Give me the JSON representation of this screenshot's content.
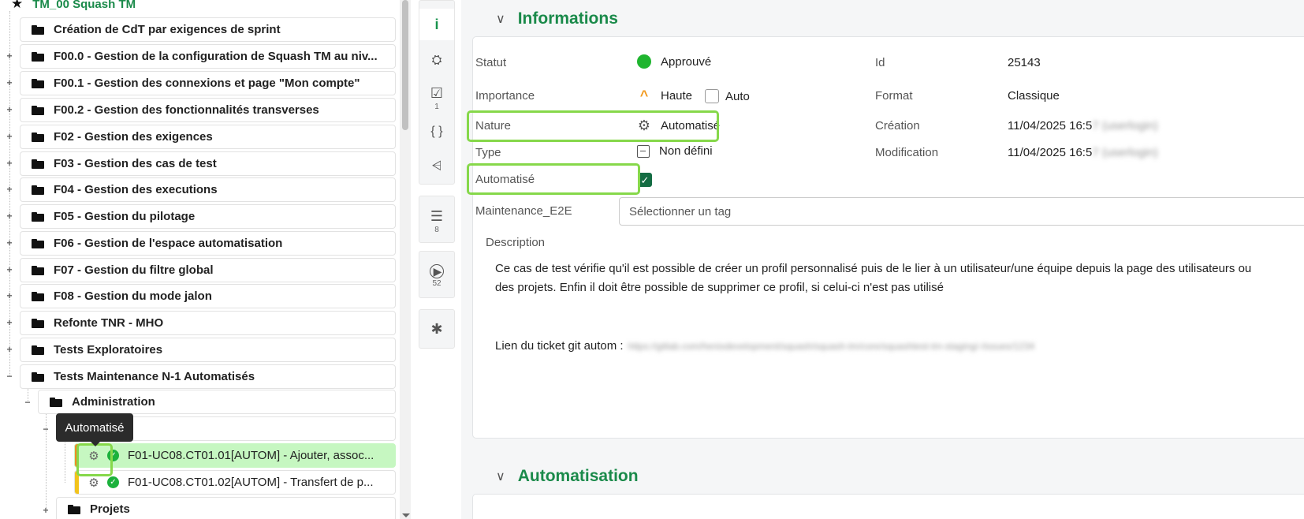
{
  "tree": {
    "project": "TM_00 Squash TM",
    "folders": [
      "Création de CdT par exigences de sprint",
      "F00.0 - Gestion de la configuration de Squash TM au niv...",
      "F00.1 - Gestion des connexions et page \"Mon compte\"",
      "F00.2 - Gestion des fonctionnalités transverses",
      "F02 - Gestion des exigences",
      "F03 - Gestion des cas de test",
      "F04 - Gestion des executions",
      "F05 - Gestion du pilotage",
      "F06 - Gestion de l'espace automatisation",
      "F07 - Gestion du filtre global",
      "F08 - Gestion du mode jalon",
      "Refonte TNR - MHO",
      "Tests Exploratoires",
      "Tests Maintenance N-1 Automatisés"
    ],
    "subfolder": "Administration",
    "test_cases": [
      "F01-UC08.CT01.01[AUTOM] - Ajouter, assoc...",
      "F01-UC08.CT01.02[AUTOM] - Transfert de p..."
    ],
    "last_folder": "Projets",
    "tooltip": "Automatisé",
    "colors": {
      "project": "#1a8a4a",
      "selected": "#c6f7c1",
      "highlight": "#86d84a",
      "orange": "#f08a2a",
      "yellow": "#f2c31c"
    }
  },
  "toolbar": {
    "buttons": [
      {
        "icon": "info-icon",
        "glyph": "i",
        "count": ""
      },
      {
        "icon": "robot-icon",
        "glyph": "🤖",
        "count": ""
      },
      {
        "icon": "checklist-icon",
        "glyph": "☑",
        "count": "1"
      },
      {
        "icon": "braces-icon",
        "glyph": "{ }",
        "count": ""
      },
      {
        "icon": "share-icon",
        "glyph": "⋖",
        "count": ""
      },
      {
        "icon": "list-icon",
        "glyph": "☰",
        "count": "8"
      },
      {
        "icon": "play-icon",
        "glyph": "▶",
        "count": "52"
      },
      {
        "icon": "bug-icon",
        "glyph": "✱",
        "count": ""
      }
    ]
  },
  "informations": {
    "title": "Informations",
    "statut_label": "Statut",
    "statut_value": "Approuvé",
    "importance_label": "Importance",
    "importance_value": "Haute",
    "auto_label": "Auto",
    "nature_label": "Nature",
    "nature_value": "Automatisé",
    "type_label": "Type",
    "type_value": "Non défini",
    "automatise_label": "Automatisé",
    "maintenance_label": "Maintenance_E2E",
    "tag_placeholder": "Sélectionner un tag",
    "id_label": "Id",
    "id_value": "25143",
    "format_label": "Format",
    "format_value": "Classique",
    "creation_label": "Création",
    "creation_value": "11/04/2025 16:5",
    "creation_blur": "7 (userlogin)",
    "modification_label": "Modification",
    "modification_value": "11/04/2025 16:5",
    "modification_blur": "7 (userlogin)",
    "description_label": "Description",
    "description_line1": "Ce cas de test vérifie qu'il est possible de créer un profil personnalisé puis de le lier à un utilisateur/une équipe depuis la page des utilisateurs ou",
    "description_line2": "des projets. Enfin il doit être possible de supprimer ce profil, si celui-ci n'est pas utilisé",
    "ticket_label": "Lien du ticket git autom :",
    "ticket_blur": "https://gitlab.com/henixdevelopment/squash/squash-tm/core/squashtest-tm-staging/-/issues/1234"
  },
  "automatisation": {
    "title": "Automatisation"
  }
}
